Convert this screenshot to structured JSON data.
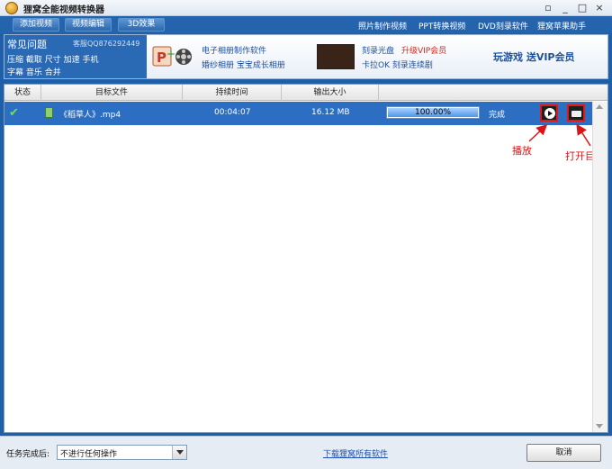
{
  "window": {
    "title": "狸窝全能视频转换器",
    "controls": [
      "▫",
      "_",
      "□",
      "×"
    ]
  },
  "toolbar": {
    "add_video": "添加视频",
    "edit_video": "视频编辑",
    "effect_3d": "3D效果",
    "links": [
      "照片制作视频",
      "PPT转换视频",
      "DVD刻录软件",
      "狸窝苹果助手"
    ]
  },
  "banner": {
    "faq_title": "常见问题",
    "faq_qq": "客服QQ876292449",
    "faq_links_row1": "压缩 截取 尺寸 加速 手机",
    "faq_links_row2": "字幕 音乐 合并",
    "promo1_line1": "电子相册制作软件",
    "promo1_line2": "婚纱相册 宝宝成长相册",
    "promo2_line1a": "刻录光盘",
    "promo2_line1b": "升级VIP会员",
    "promo2_line2": "卡拉OK 刻录连续剧",
    "vip_promo": "玩游戏 送VIP会员"
  },
  "table": {
    "headers": [
      "状态",
      "目标文件",
      "持续时间",
      "输出大小"
    ],
    "rows": [
      {
        "state_icon": "check-icon",
        "file": "《稻草人》.mp4",
        "duration": "00:04:07",
        "size": "16.12 MB",
        "progress_text": "100.00%",
        "progress_fraction": 1.0,
        "status": "完成"
      }
    ]
  },
  "annotations": {
    "play": "播放",
    "open_dir": "打开目录"
  },
  "bottom": {
    "task_done_label": "任务完成后:",
    "task_done_value": "不进行任何操作",
    "download_link": "下载狸窝所有软件",
    "cancel": "取消"
  },
  "colors": {
    "accent_blue": "#2c6ec1",
    "annotation_red": "#d81414"
  }
}
